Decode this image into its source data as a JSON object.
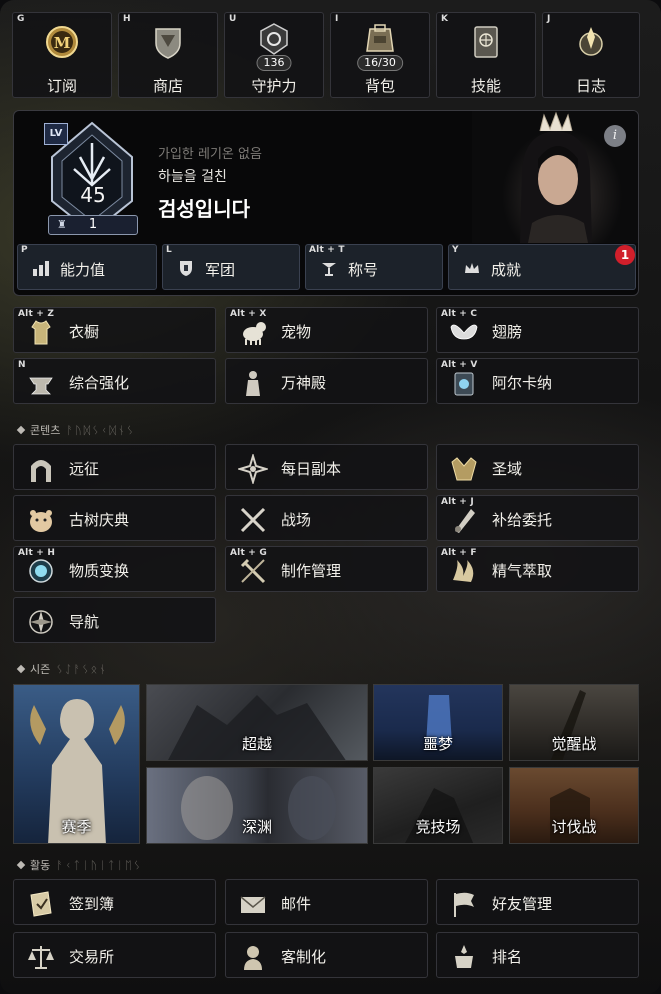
{
  "top_nav": [
    {
      "key": "G",
      "label": "订阅",
      "icon": "subscription-medal-icon"
    },
    {
      "key": "H",
      "label": "商店",
      "icon": "shop-shield-icon"
    },
    {
      "key": "U",
      "label": "守护力",
      "icon": "guardian-power-icon",
      "value": "136"
    },
    {
      "key": "I",
      "label": "背包",
      "icon": "backpack-icon",
      "value": "16/30"
    },
    {
      "key": "K",
      "label": "技能",
      "icon": "skill-book-icon"
    },
    {
      "key": "J",
      "label": "日志",
      "icon": "journal-icon"
    }
  ],
  "profile": {
    "lv_badge": "LV",
    "level": "45",
    "rank": "1",
    "legion_status": "가입한 레기온 없음",
    "title": "하늘을 걸친",
    "name": "검성입니다",
    "info": "i"
  },
  "profile_tabs": [
    {
      "key": "P",
      "label": "能力值",
      "icon": "stats-bars-icon"
    },
    {
      "key": "L",
      "label": "军团",
      "icon": "legion-shield-icon"
    },
    {
      "key": "Alt + T",
      "label": "称号",
      "icon": "title-icon"
    },
    {
      "key": "Y",
      "label": "成就",
      "icon": "achievement-crown-icon",
      "alert": "1"
    }
  ],
  "character_menu": [
    {
      "key": "Alt + Z",
      "label": "衣橱",
      "icon": "wardrobe-icon"
    },
    {
      "key": "Alt + X",
      "label": "宠物",
      "icon": "pet-icon"
    },
    {
      "key": "Alt + C",
      "label": "翅膀",
      "icon": "wings-icon"
    },
    {
      "key": "N",
      "label": "综合强化",
      "icon": "anvil-icon"
    },
    {
      "key": "",
      "label": "万神殿",
      "icon": "pantheon-statue-icon"
    },
    {
      "key": "Alt + V",
      "label": "阿尔卡纳",
      "icon": "arcana-icon"
    }
  ],
  "content_section": {
    "label": "콘텐츠"
  },
  "content_menu": [
    {
      "key": "",
      "label": "远征",
      "icon": "expedition-gate-icon"
    },
    {
      "key": "",
      "label": "每日副本",
      "icon": "daily-dungeon-icon"
    },
    {
      "key": "",
      "label": "圣域",
      "icon": "sanctuary-icon"
    },
    {
      "key": "",
      "label": "古树庆典",
      "icon": "festival-hamster-icon"
    },
    {
      "key": "",
      "label": "战场",
      "icon": "battlefield-swords-icon"
    },
    {
      "key": "Alt + J",
      "label": "补给委托",
      "icon": "supply-quest-icon"
    },
    {
      "key": "Alt + H",
      "label": "物质变换",
      "icon": "transmute-orb-icon"
    },
    {
      "key": "Alt + G",
      "label": "制作管理",
      "icon": "crafting-tools-icon"
    },
    {
      "key": "Alt + F",
      "label": "精气萃取",
      "icon": "extraction-icon"
    },
    {
      "key": "",
      "label": "导航",
      "icon": "compass-icon"
    }
  ],
  "season_section": {
    "label": "시즌"
  },
  "season_tiles": [
    {
      "label": "赛季",
      "icon": "season-goddess-image"
    },
    {
      "label": "超越",
      "icon": "transcend-image"
    },
    {
      "label": "噩梦",
      "icon": "nightmare-image"
    },
    {
      "label": "觉醒战",
      "icon": "awakening-battle-image"
    },
    {
      "label": "深渊",
      "icon": "abyss-image"
    },
    {
      "label": "竞技场",
      "icon": "arena-image"
    },
    {
      "label": "讨伐战",
      "icon": "subjugation-image"
    }
  ],
  "activity_section": {
    "label": "활동"
  },
  "activity_menu": [
    {
      "label": "签到簿",
      "icon": "checkin-book-icon"
    },
    {
      "label": "邮件",
      "icon": "mail-envelope-icon"
    },
    {
      "label": "好友管理",
      "icon": "friends-flag-icon"
    },
    {
      "label": "交易所",
      "icon": "exchange-scales-icon"
    },
    {
      "label": "客制化",
      "icon": "customize-bust-icon"
    },
    {
      "label": "排名",
      "icon": "ranking-icon"
    }
  ],
  "colors": {
    "accent_gold": "#c9b27a",
    "alert_red": "#d11f2b",
    "tab_blue": "#1e242c"
  }
}
